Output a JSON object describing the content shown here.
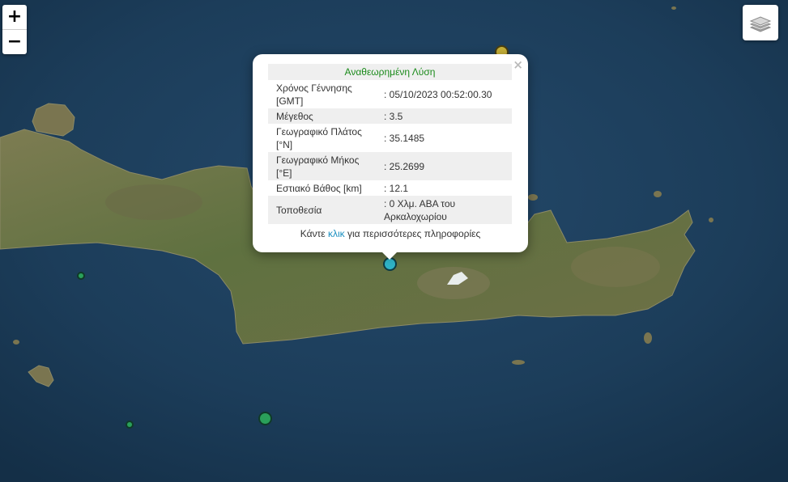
{
  "map": {
    "zoom_in_label": "+",
    "zoom_out_label": "−",
    "layers_icon": "layers-icon",
    "colors": {
      "sea": "#1d3f5c",
      "land": "#6a7846",
      "marker_selected": "#2fb3c6",
      "marker_green": "#2aa05a",
      "marker_yellow": "#c9b33a"
    }
  },
  "popup": {
    "title": "Αναθεωρημένη Λύση",
    "close_label": "×",
    "rows": [
      {
        "label": "Χρόνος Γέννησης [GMT]",
        "value": ": 05/10/2023 00:52:00.30"
      },
      {
        "label": "Μέγεθος",
        "value": ": 3.5"
      },
      {
        "label": "Γεωγραφικό Πλάτος [°N]",
        "value": ": 35.1485"
      },
      {
        "label": "Γεωγραφικό Μήκος [°E]",
        "value": ": 25.2699"
      },
      {
        "label": "Εστιακό Βάθος [km]",
        "value": ": 12.1"
      },
      {
        "label": "Τοποθεσία",
        "value": ": 0 Χλμ. ΑΒΑ του Αρκαλοχωρίου"
      }
    ],
    "footer_prefix": "Κάντε ",
    "footer_link": "κλικ",
    "footer_suffix": " για περισσότερες πληροφορίες"
  }
}
